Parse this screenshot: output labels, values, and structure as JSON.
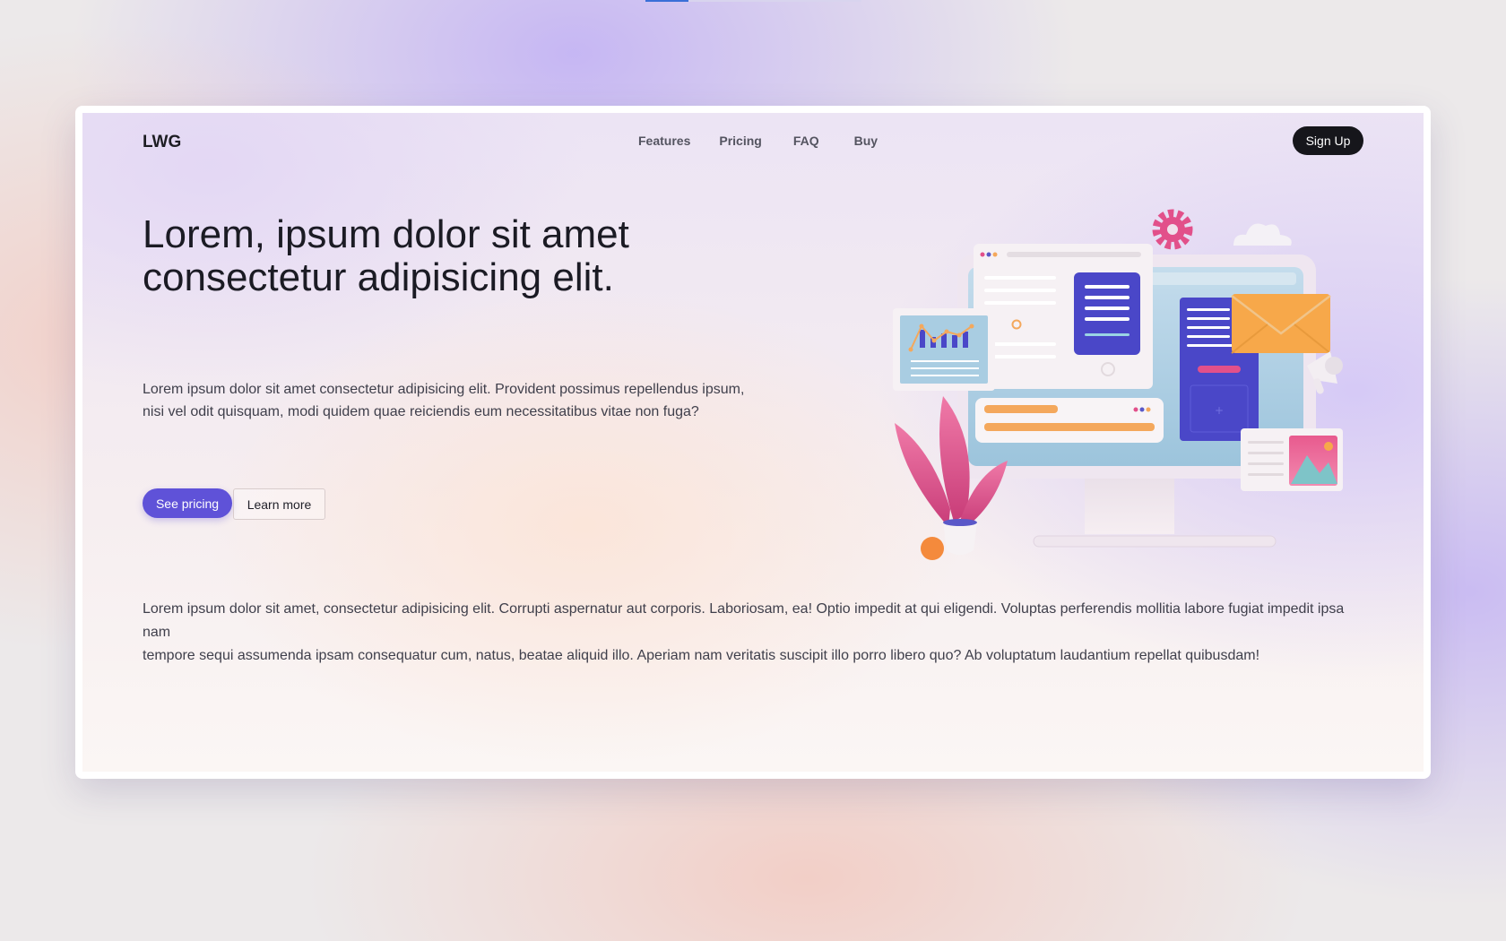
{
  "progress": {
    "value": 0.2
  },
  "nav": {
    "logo": "LWG",
    "links": [
      "Features",
      "Pricing",
      "FAQ",
      "Buy"
    ],
    "signup_label": "Sign Up"
  },
  "hero": {
    "title_line1": "Lorem, ipsum dolor sit amet",
    "title_line2": "consectetur adipisicing elit.",
    "text_line1": "Lorem ipsum dolor sit amet consectetur adipisicing elit. Provident possimus repellendus ipsum,",
    "text_line2": "nisi vel odit quisquam, modi quidem quae reiciendis eum necessitatibus vitae non fuga?",
    "primary_button": "See pricing",
    "secondary_button": "Learn more"
  },
  "body": {
    "line1": "Lorem ipsum dolor sit amet, consectetur adipisicing elit. Corrupti aspernatur aut corporis. Laboriosam, ea! Optio impedit at qui eligendi. Voluptas perferendis mollitia labore fugiat impedit ipsa nam",
    "line2": "tempore sequi assumenda ipsam consequatur cum, natus, beatae aliquid illo. Aperiam nam veritatis suscipit illo porro libero quo? Ab voluptatum laudantium repellat quibusdam!"
  },
  "colors": {
    "accent": "#5f52d8",
    "dark": "#16161b",
    "monitor_blue": "#a9cde2",
    "panel_indigo": "#4a47c8",
    "envelope_orange": "#f7a84a",
    "plant_pink": "#e0508e"
  },
  "icons": [
    "gear-icon",
    "cloud-icon",
    "envelope-icon",
    "megaphone-icon",
    "image-icon",
    "chart-icon"
  ]
}
